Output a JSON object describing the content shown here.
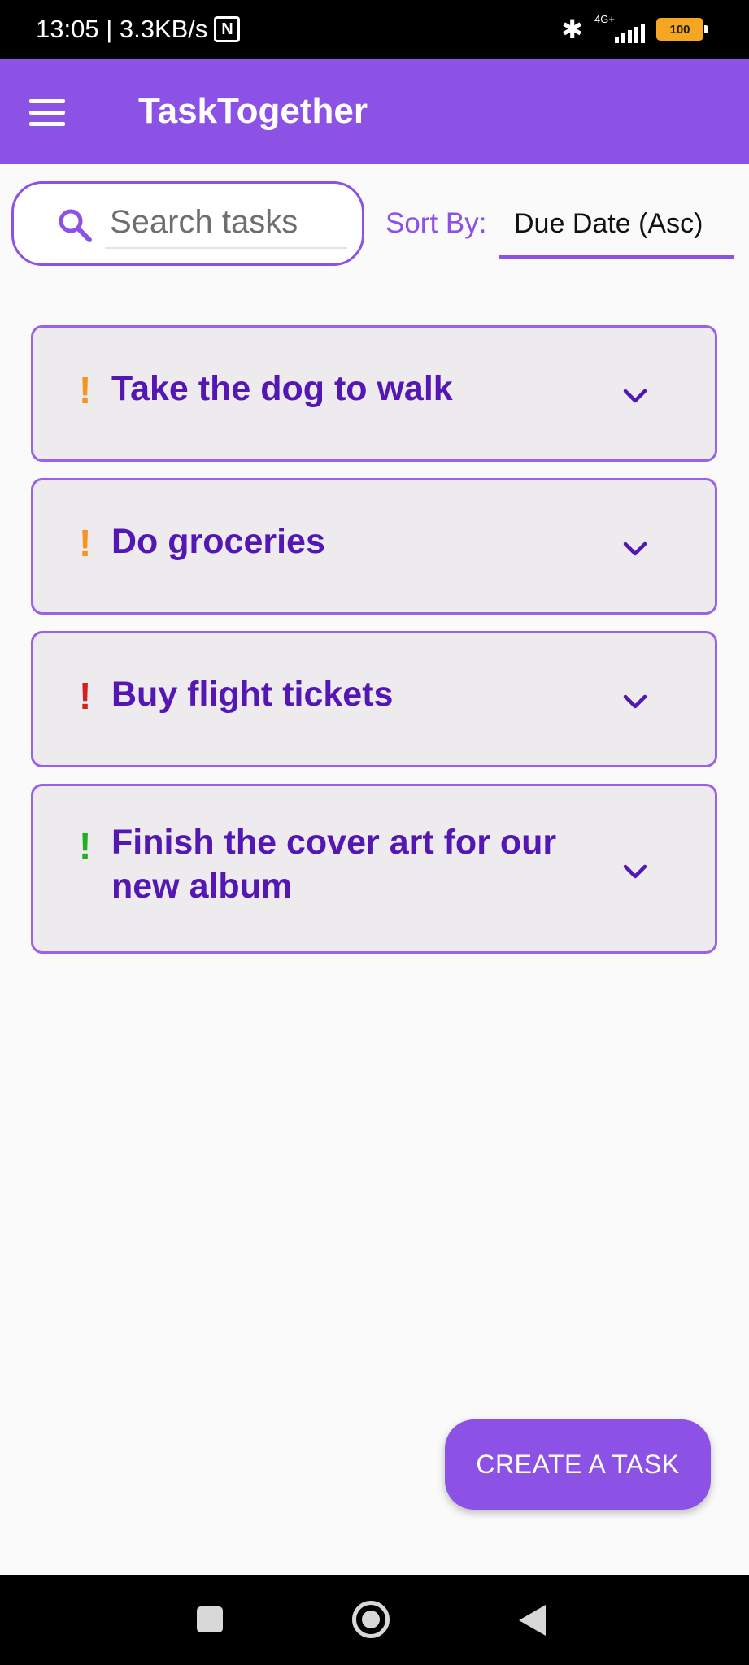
{
  "status_bar": {
    "time_speed": "13:05 | 3.3KB/s",
    "nfc_icon": "nfc-icon",
    "network": "4G+",
    "battery": "100"
  },
  "app_bar": {
    "title": "TaskTogether",
    "menu_icon": "hamburger-menu-icon"
  },
  "search": {
    "placeholder": "Search tasks",
    "value": "",
    "icon": "search-icon"
  },
  "sort": {
    "label": "Sort By:",
    "selected": "Due Date (Asc)"
  },
  "tasks": [
    {
      "title": "Take the dog to walk",
      "priority_mark": "!",
      "priority_color": "#F7931E"
    },
    {
      "title": "Do groceries",
      "priority_mark": "!",
      "priority_color": "#F7931E"
    },
    {
      "title": "Buy flight tickets",
      "priority_mark": "!",
      "priority_color": "#D42020"
    },
    {
      "title": "Finish the cover art for our new album",
      "priority_mark": "!",
      "priority_color": "#22B022"
    }
  ],
  "create_button": {
    "label": "CREATE A TASK"
  },
  "colors": {
    "accent": "#8C52E5",
    "task_title": "#5417B4",
    "card_background": "#EDEBEE",
    "card_border": "#9A62E8"
  }
}
